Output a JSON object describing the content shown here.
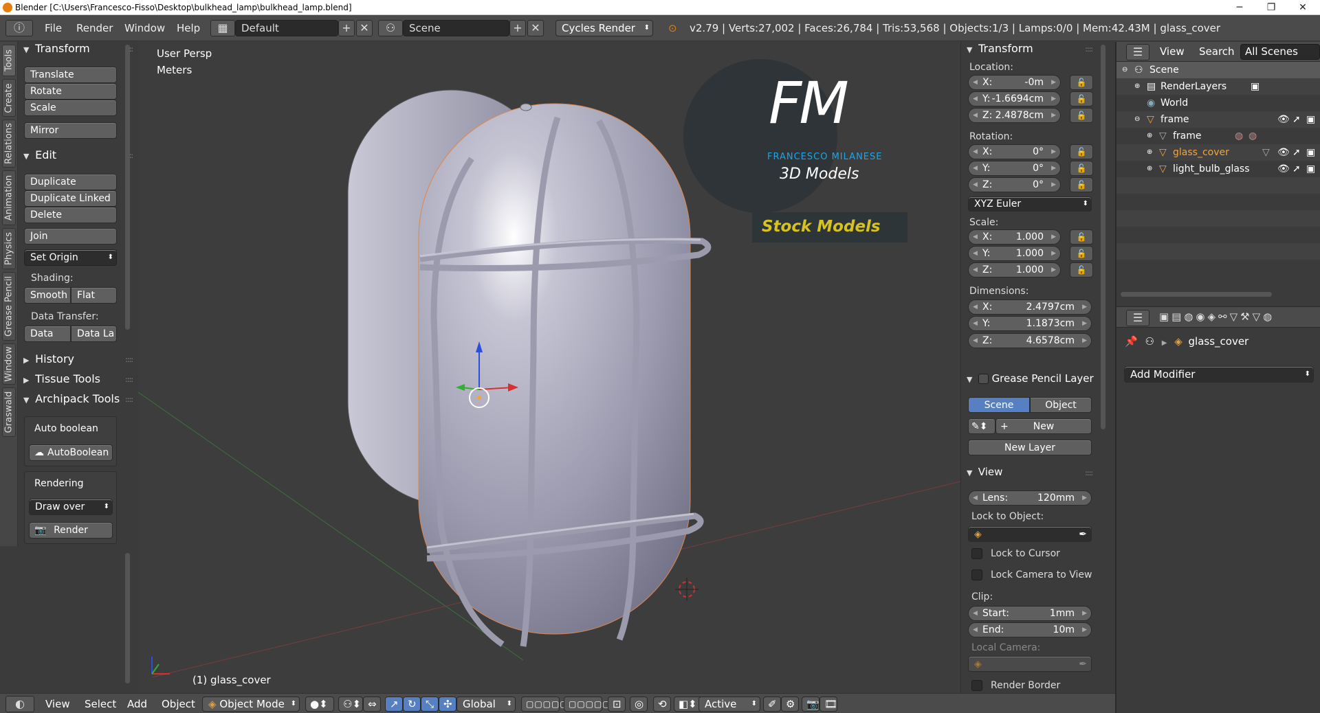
{
  "window": {
    "title": "Blender [C:\\Users\\Francesco-Fisso\\Desktop\\bulkhead_lamp\\bulkhead_lamp.blend]",
    "minimize": "─",
    "maximize": "❐",
    "close": "✕"
  },
  "topbar": {
    "menus": [
      "File",
      "Render",
      "Window",
      "Help"
    ],
    "layout_name": "Default",
    "scene_name": "Scene",
    "render_engine": "Cycles Render",
    "stats": "v2.79 | Verts:27,002 | Faces:26,784 | Tris:53,568 | Objects:1/3 | Lamps:0/0 | Mem:42.43M | glass_cover"
  },
  "left_tabs": [
    "Tools",
    "Create",
    "Relations",
    "Animation",
    "Physics",
    "Grease Pencil",
    "Window",
    "Graswald"
  ],
  "toolshelf": {
    "transform": {
      "title": "Transform",
      "buttons": [
        "Translate",
        "Rotate",
        "Scale",
        "Mirror"
      ]
    },
    "edit": {
      "title": "Edit",
      "buttons": [
        "Duplicate",
        "Duplicate Linked",
        "Delete",
        "Join"
      ],
      "set_origin": "Set Origin",
      "shading_label": "Shading:",
      "smooth": "Smooth",
      "flat": "Flat",
      "data_transfer_label": "Data Transfer:",
      "data": "Data",
      "data_la": "Data La"
    },
    "history": "History",
    "tissue": "Tissue Tools",
    "archipack": {
      "title": "Archipack Tools",
      "auto_boolean_label": "Auto boolean",
      "auto_boolean_btn": "AutoBoolean",
      "rendering_label": "Rendering",
      "draw_over": "Draw over",
      "render": "Render"
    }
  },
  "viewport": {
    "view_name": "User Persp",
    "units": "Meters",
    "active_object": "(1) glass_cover",
    "logo_letters": "FM",
    "logo_name": "FRANCESCO MILANESE",
    "logo_sub": "3D Models",
    "stock": "Stock Models"
  },
  "npanel": {
    "transform_title": "Transform",
    "location_label": "Location:",
    "location": [
      {
        "k": "X:",
        "v": "-0m"
      },
      {
        "k": "Y:",
        "v": "-1.6694cm"
      },
      {
        "k": "Z:",
        "v": "2.4878cm"
      }
    ],
    "rotation_label": "Rotation:",
    "rotation": [
      {
        "k": "X:",
        "v": "0°"
      },
      {
        "k": "Y:",
        "v": "0°"
      },
      {
        "k": "Z:",
        "v": "0°"
      }
    ],
    "rotation_mode": "XYZ Euler",
    "scale_label": "Scale:",
    "scale": [
      {
        "k": "X:",
        "v": "1.000"
      },
      {
        "k": "Y:",
        "v": "1.000"
      },
      {
        "k": "Z:",
        "v": "1.000"
      }
    ],
    "dimensions_label": "Dimensions:",
    "dimensions": [
      {
        "k": "X:",
        "v": "2.4797cm"
      },
      {
        "k": "Y:",
        "v": "1.1873cm"
      },
      {
        "k": "Z:",
        "v": "4.6578cm"
      }
    ],
    "gp_title": "Grease Pencil Layer",
    "gp_scene": "Scene",
    "gp_object": "Object",
    "gp_new": "New",
    "gp_new_layer": "New Layer",
    "view_title": "View",
    "lens_k": "Lens:",
    "lens_v": "120mm",
    "lock_to_object": "Lock to Object:",
    "lock_to_cursor": "Lock to Cursor",
    "lock_camera": "Lock Camera to View",
    "clip_label": "Clip:",
    "clip_start_k": "Start:",
    "clip_start_v": "1mm",
    "clip_end_k": "End:",
    "clip_end_v": "10m",
    "local_camera": "Local Camera:",
    "render_border": "Render Border"
  },
  "outliner": {
    "view": "View",
    "search": "Search",
    "all_scenes": "All Scenes",
    "rows": [
      "Scene",
      "RenderLayers",
      "World",
      "frame",
      "frame",
      "glass_cover",
      "light_bulb_glass"
    ]
  },
  "properties": {
    "object_name": "glass_cover",
    "add_modifier": "Add Modifier"
  },
  "bottombar": {
    "menus": [
      "View",
      "Select",
      "Add",
      "Object"
    ],
    "mode": "Object Mode",
    "orientation": "Global",
    "pivot_active": "Active"
  },
  "colors": {
    "accent_blue": "#5680c2",
    "logo_blue": "#1ea6e6",
    "stock_yellow": "#d8c31e",
    "selected_orange": "#f2a53a"
  }
}
